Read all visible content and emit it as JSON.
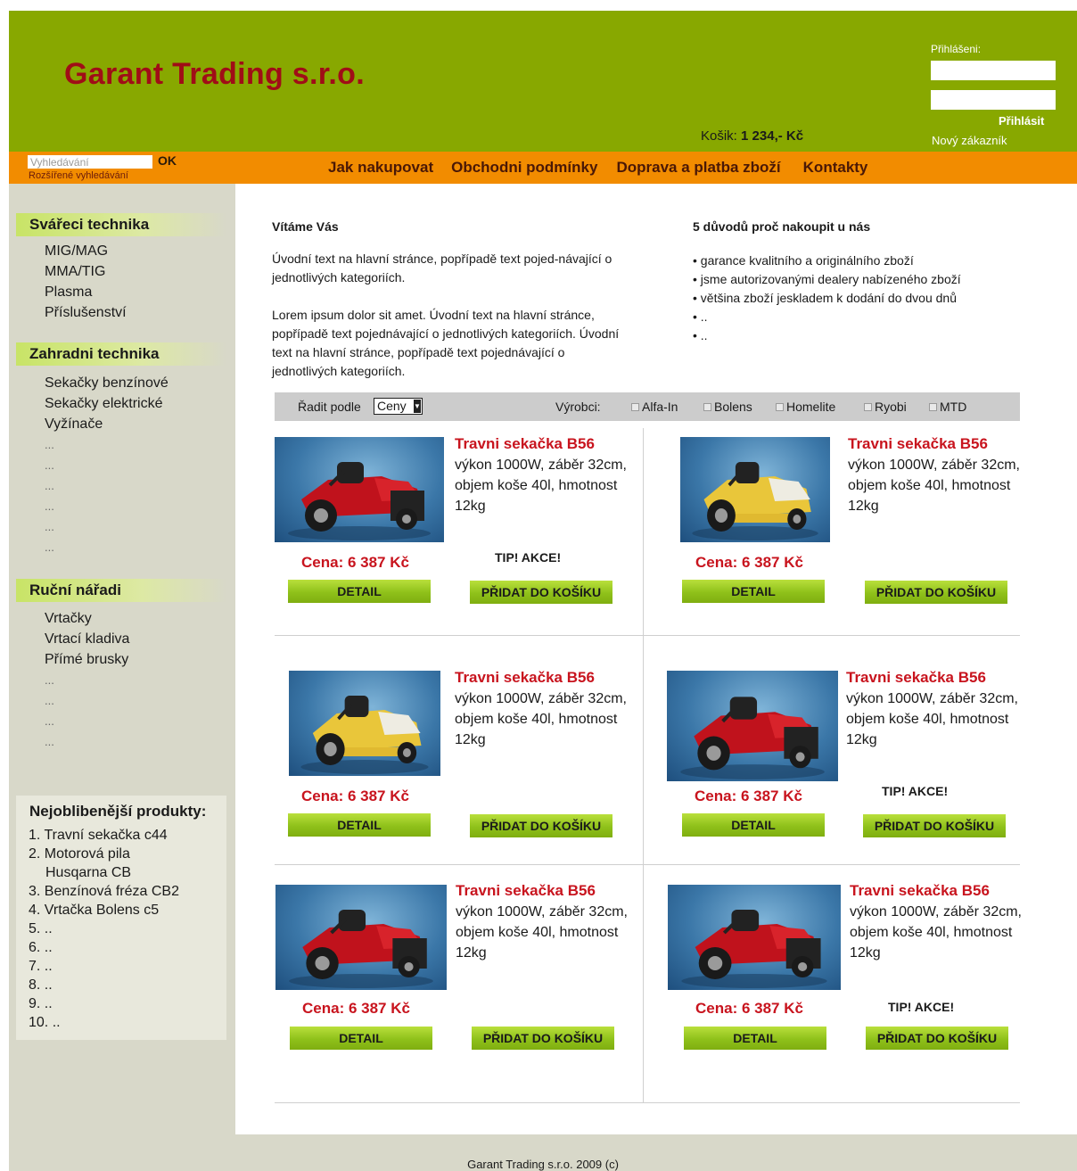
{
  "header": {
    "logo": "Garant Trading s.r.o.",
    "cart_label": "Košik:",
    "cart_total": "1 234,- Kč",
    "login_label": "Přihlášeni:",
    "login_button": "Přihlásit",
    "new_customer": "Nový zákazník"
  },
  "navbar": {
    "search_placeholder": "Vyhledávání",
    "search_button": "OK",
    "advanced_search": "Rozšířené vyhledávání",
    "links": [
      "Jak nakupovat",
      "Obchodni podmínky",
      "Doprava a platba zboží",
      "Kontakty"
    ]
  },
  "sidebar": {
    "categories": [
      {
        "title": "Svářeci technika",
        "items": [
          "MIG/MAG",
          "MMA/TIG",
          "Plasma",
          "Příslušenství"
        ]
      },
      {
        "title": "Zahradni technika",
        "items": [
          "Sekačky benzínové",
          "Sekačky elektrické",
          "Vyžínače",
          "...",
          "...",
          "...",
          "...",
          "...",
          "..."
        ]
      },
      {
        "title": "Ruční nářadi",
        "items": [
          "Vrtačky",
          "Vrtací kladiva",
          "Přímé brusky",
          "...",
          "...",
          "...",
          "..."
        ]
      }
    ],
    "popular": {
      "title": "Nejoblibenější produkty:",
      "items": [
        "1. Travní sekačka c44",
        "2. Motorová pila",
        "Husqarna CB",
        "3. Benzínová fréza CB2",
        "4. Vrtačka Bolens c5",
        "5. ..",
        "6. ..",
        "7. ..",
        "8. ..",
        "9. ..",
        "10. .."
      ]
    }
  },
  "welcome": {
    "title": "Vítáme Vás",
    "p1": "Úvodní text na hlavní stránce, popřípadě text pojed-návající o jednotlivých kategoriích.",
    "p2": "Lorem ipsum dolor sit amet. Úvodní text na hlavní stránce, popřípadě text pojednávající o jednotlivých kategoriích. Úvodní text na hlavní stránce, popřípadě text pojednávající o jednotlivých kategoriích."
  },
  "reasons": {
    "title": "5 důvodů proč nakoupit u nás",
    "items": [
      "• garance kvalitního a originálního zboží",
      "• jsme autorizovanými dealery nabízeného zboží",
      "• většina zboží jeskladem k dodání do dvou dnů",
      "• ..",
      "• .."
    ]
  },
  "filter": {
    "sort_label": "Řadit podle",
    "sort_value": "Ceny",
    "maker_label": "Výrobci:",
    "makers": [
      "Alfa-In",
      "Bolens",
      "Homelite",
      "Ryobi",
      "MTD"
    ]
  },
  "products": [
    {
      "title": "Travni sekačka B56",
      "desc": "výkon 1000W, záběr 32cm, objem koše 40l, hmotnost 12kg",
      "price": "Cena: 6 387 Kč",
      "tip": "TIP!  AKCE!",
      "detail": "DETAIL",
      "cart": "PŘIDAT DO KOŠÍKU",
      "mower": "red"
    },
    {
      "title": "Travni sekačka B56",
      "desc": "výkon 1000W, záběr 32cm, objem koše 40l, hmotnost 12kg",
      "price": "Cena: 6 387 Kč",
      "tip": "",
      "detail": "DETAIL",
      "cart": "PŘIDAT DO KOŠÍKU",
      "mower": "yellow"
    },
    {
      "title": "Travni sekačka B56",
      "desc": "výkon 1000W, záběr 32cm, objem koše 40l, hmotnost 12kg",
      "price": "Cena: 6 387 Kč",
      "tip": "",
      "detail": "DETAIL",
      "cart": "PŘIDAT DO KOŠÍKU",
      "mower": "yellow"
    },
    {
      "title": "Travni sekačka B56",
      "desc": "výkon 1000W, záběr 32cm, objem koše 40l, hmotnost 12kg",
      "price": "Cena: 6 387 Kč",
      "tip": "TIP!  AKCE!",
      "detail": "DETAIL",
      "cart": "PŘIDAT DO KOŠÍKU",
      "mower": "red"
    },
    {
      "title": "Travni sekačka B56",
      "desc": "výkon 1000W, záběr 32cm, objem koše 40l, hmotnost 12kg",
      "price": "Cena: 6 387 Kč",
      "tip": "",
      "detail": "DETAIL",
      "cart": "PŘIDAT DO KOŠÍKU",
      "mower": "red"
    },
    {
      "title": "Travni sekačka B56",
      "desc": "výkon 1000W, záběr 32cm, objem koše 40l, hmotnost 12kg",
      "price": "Cena: 6 387 Kč",
      "tip": "TIP!  AKCE!",
      "detail": "DETAIL",
      "cart": "PŘIDAT DO KOŠÍKU",
      "mower": "red"
    }
  ],
  "colors": {
    "header_green": "#88a800",
    "nav_orange": "#f28c00",
    "logo_red": "#a00d17",
    "price_red": "#c8141e",
    "button_green": "#8fc11a",
    "sidebar_bg": "#d8d8c9"
  },
  "footer": "Garant Trading s.r.o. 2009 (c)"
}
